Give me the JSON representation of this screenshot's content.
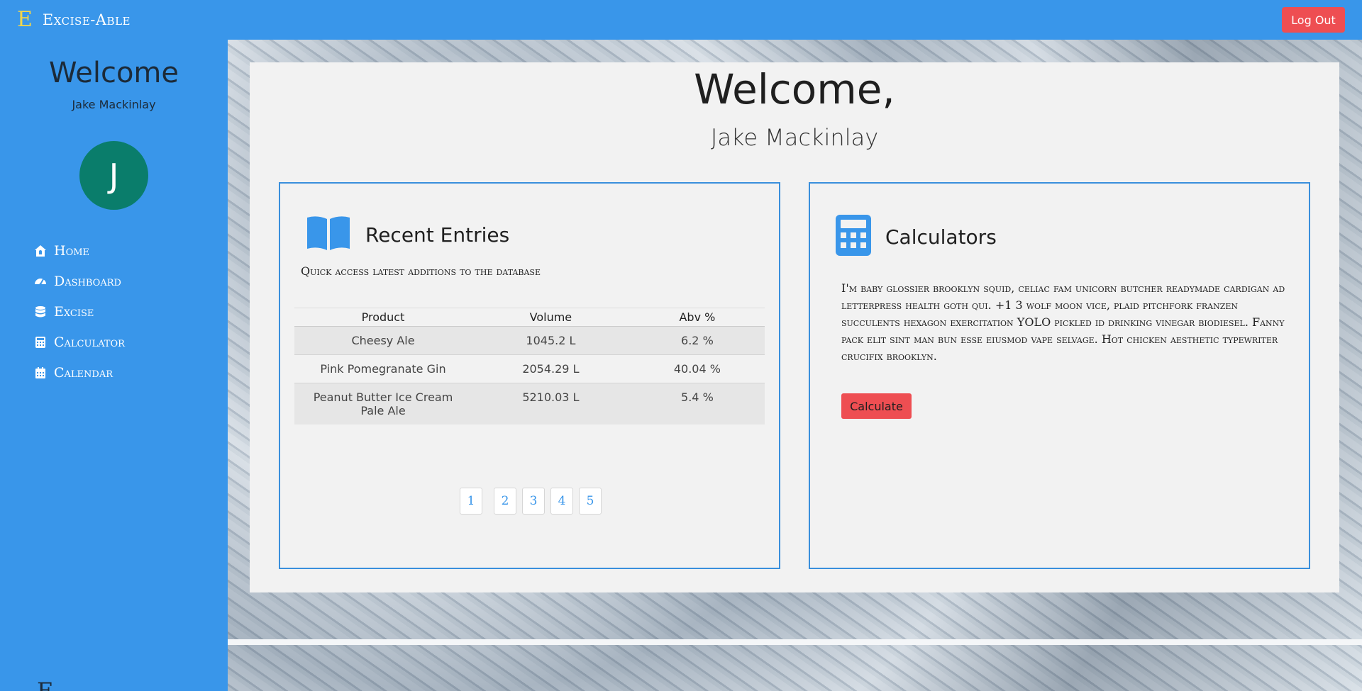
{
  "topbar": {
    "brand_logo": "E",
    "brand_name": "Excise-Able",
    "logout_label": "Log Out"
  },
  "sidebar": {
    "welcome": "Welcome",
    "user_name": "Jake Mackinlay",
    "avatar_letter": "J",
    "items": [
      {
        "label": "Home",
        "icon": "home-icon"
      },
      {
        "label": "Dashboard",
        "icon": "dashboard-icon"
      },
      {
        "label": "Excise",
        "icon": "database-icon"
      },
      {
        "label": "Calculator",
        "icon": "calculator-icon"
      },
      {
        "label": "Calendar",
        "icon": "calendar-icon"
      }
    ],
    "footer_glyph": "E"
  },
  "main": {
    "title": "Welcome,",
    "subtitle": "Jake Mackinlay"
  },
  "recent": {
    "title": "Recent Entries",
    "subtitle": "Quick access latest additions to the database",
    "columns": [
      "Product",
      "Volume",
      "Abv %"
    ],
    "rows": [
      {
        "product": "Cheesy Ale",
        "volume": "1045.2 L",
        "abv": "6.2 %"
      },
      {
        "product": "Pink Pomegranate Gin",
        "volume": "2054.29 L",
        "abv": "40.04 %"
      },
      {
        "product": "Peanut Butter Ice Cream Pale Ale",
        "volume": "5210.03 L",
        "abv": "5.4 %"
      }
    ],
    "pages": [
      "1",
      "2",
      "3",
      "4",
      "5"
    ],
    "current_page": "1"
  },
  "calculators": {
    "title": "Calculators",
    "body": "I'm baby glossier brooklyn squid, celiac fam unicorn butcher readymade cardigan ad letterpress health goth qui. +1 3 wolf moon vice, plaid pitchfork franzen succulents hexagon exercitation YOLO pickled id drinking vinegar biodiesel. Fanny pack elit sint man bun esse eiusmod vape selvage. Hot chicken aesthetic typewriter crucifix brooklyn.",
    "button_label": "Calculate"
  },
  "colors": {
    "primary": "#3996ea",
    "danger": "#ee4e52",
    "avatar": "#0a7d6b",
    "brand_logo": "#f2d64b"
  }
}
